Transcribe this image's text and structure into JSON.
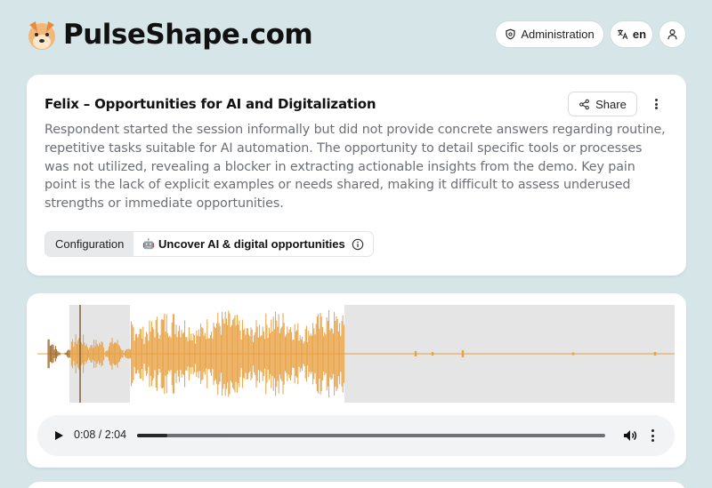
{
  "header": {
    "site_name": "PulseShape.com",
    "admin_label": "Administration",
    "language": "en"
  },
  "summary_card": {
    "title": "Felix – Opportunities for AI and Digitalization",
    "share_label": "Share",
    "summary_text": "Respondent started the session informally but did not provide concrete answers regarding routine, repetitive tasks suitable for AI automation. The opportunity to detail specific tools or processes was not utilized, revealing a blocker in extracting actionable insights from the demo. Key pain point is the lack of explicit examples or needs shared, making it difficult to assess underused strengths or immediate opportunities.",
    "config_label": "Configuration",
    "config_value": "Uncover AI & digital opportunities",
    "config_icon": "robot-icon"
  },
  "audio": {
    "current_time": "0:08",
    "duration": "2:04",
    "time_display": "0:08 / 2:04",
    "progress_fraction": 0.065,
    "waveform_color": "#e8a040",
    "played_color": "#a06a28",
    "playhead_fraction": 0.065
  },
  "colors": {
    "background": "#d6e6e8",
    "card": "#ffffff",
    "accent": "#e8a040"
  }
}
